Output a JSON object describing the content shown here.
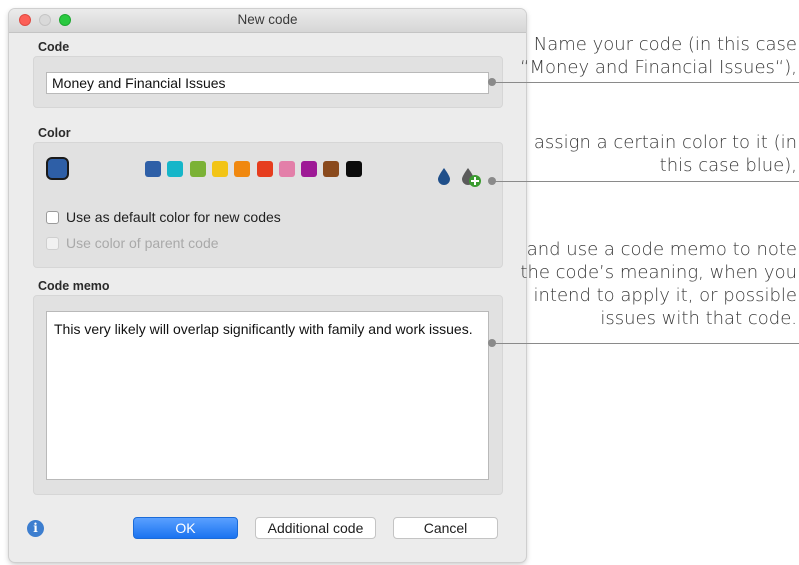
{
  "window": {
    "title": "New code"
  },
  "code_section": {
    "label": "Code",
    "value": "Money and Financial Issues"
  },
  "color_section": {
    "label": "Color",
    "selected_color": "#2e5fa7",
    "palette": [
      "#2e5fa7",
      "#16b6c9",
      "#7bb236",
      "#f2c416",
      "#f0880f",
      "#e63d1e",
      "#e37fa9",
      "#9e1a96",
      "#8a4a1d",
      "#0c0c0c"
    ],
    "icons": [
      "color-drop-icon",
      "add-color-icon"
    ],
    "default_checkbox_label": "Use as default color for new codes",
    "parent_checkbox_label": "Use color of parent code"
  },
  "memo_section": {
    "label": "Code memo",
    "text": "This very likely will overlap significantly with family and work issues."
  },
  "buttons": {
    "ok": "OK",
    "additional": "Additional code",
    "cancel": "Cancel"
  },
  "info_icon": "i",
  "annotations": {
    "a1_line1": "Name your code (in this case",
    "a1_line2": "“Money and Financial Issues“),",
    "a2_line1": "assign a certain color to it (in",
    "a2_line2": "this case blue),",
    "a3_line1": "and use a code memo to note",
    "a3_line2": "the code’s meaning, when you",
    "a3_line3": "intend to apply it, or possible",
    "a3_line4": "issues with that code."
  }
}
